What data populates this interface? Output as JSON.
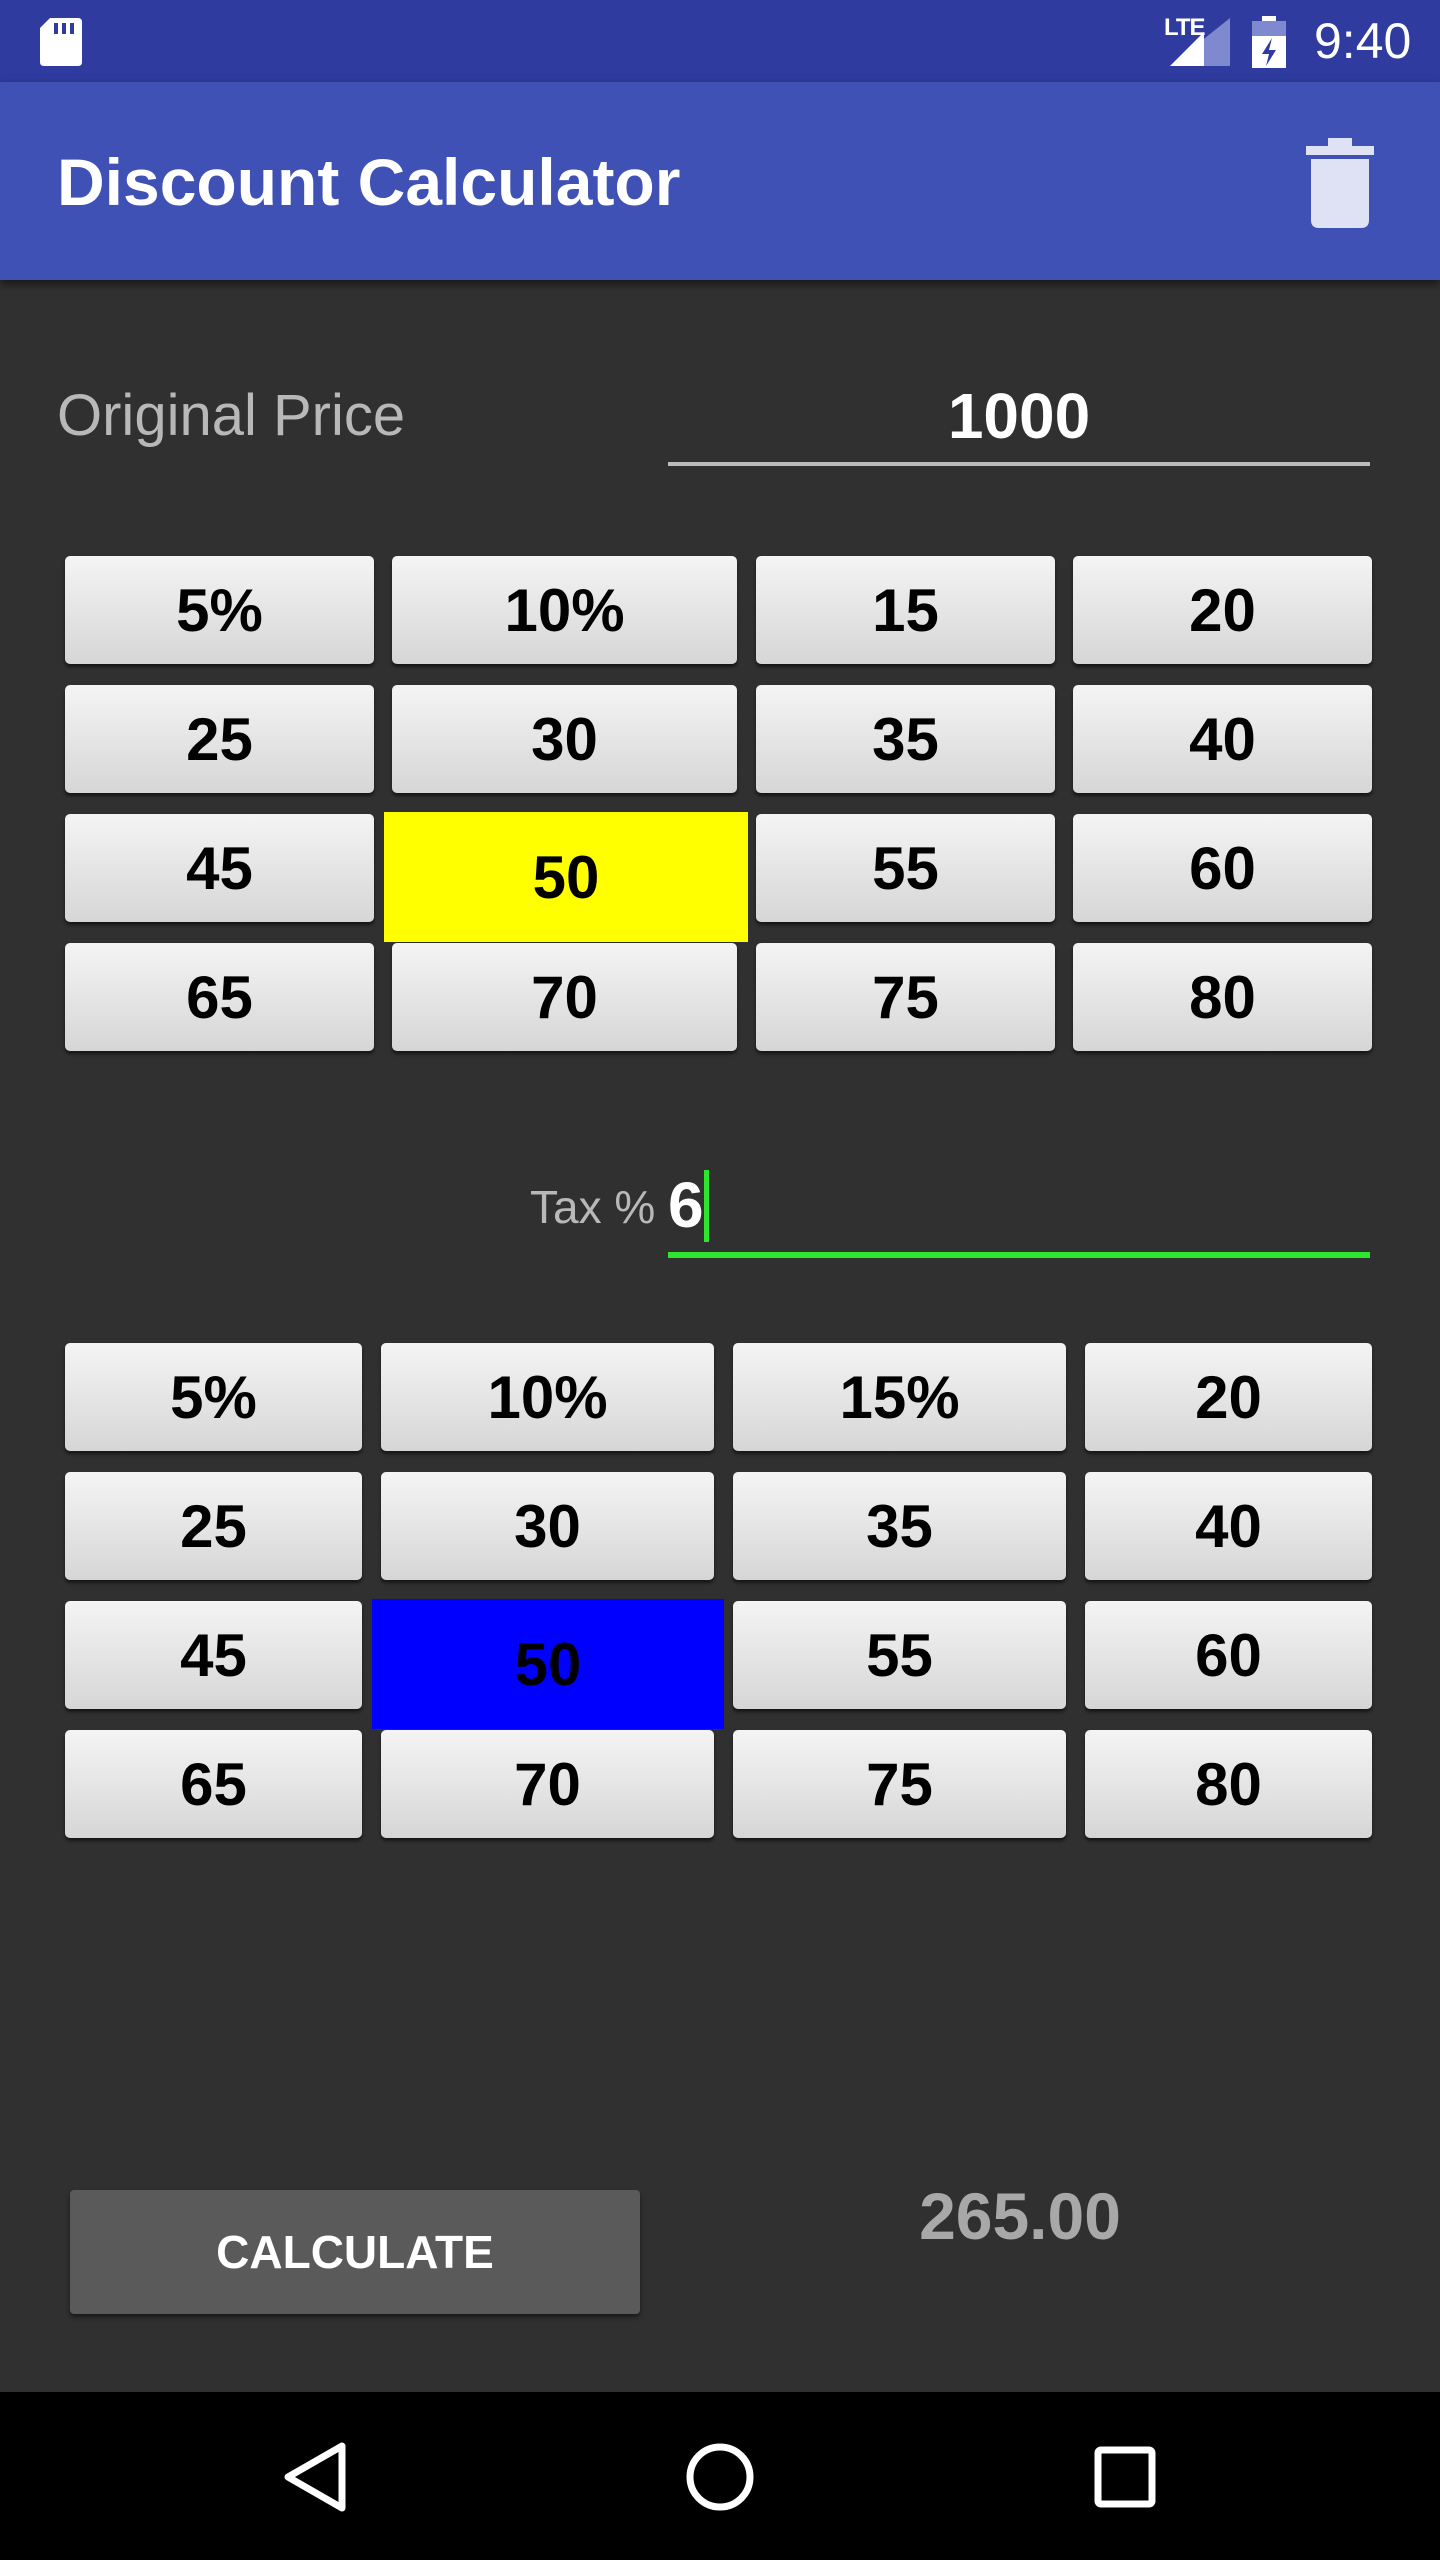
{
  "status_bar": {
    "network": "LTE",
    "time": "9:40"
  },
  "app_bar": {
    "title": "Discount Calculator",
    "clear_icon": "trash-icon"
  },
  "price": {
    "label": "Original Price",
    "value": "1000"
  },
  "discount_buttons": [
    [
      "5%",
      "10%",
      "15",
      "20"
    ],
    [
      "25",
      "30",
      "35",
      "40"
    ],
    [
      "45",
      "50",
      "55",
      "60"
    ],
    [
      "65",
      "70",
      "75",
      "80"
    ]
  ],
  "discount_selected": "50",
  "tax": {
    "label": "Tax %",
    "value": "6"
  },
  "tax_buttons": [
    [
      "5%",
      "10%",
      "15%",
      "20"
    ],
    [
      "25",
      "30",
      "35",
      "40"
    ],
    [
      "45",
      "50",
      "55",
      "60"
    ],
    [
      "65",
      "70",
      "75",
      "80"
    ]
  ],
  "tax_selected": "50",
  "calculate_label": "CALCULATE",
  "result": "265.00",
  "colors": {
    "status_bar": "#2f3b9e",
    "app_bar": "#3f51b5",
    "background": "#303030",
    "discount_highlight": "#ffff00",
    "tax_highlight": "#0000ff",
    "tax_underline": "#2ee62e"
  },
  "nav": {
    "back": "back-icon",
    "home": "home-icon",
    "recents": "recents-icon"
  }
}
